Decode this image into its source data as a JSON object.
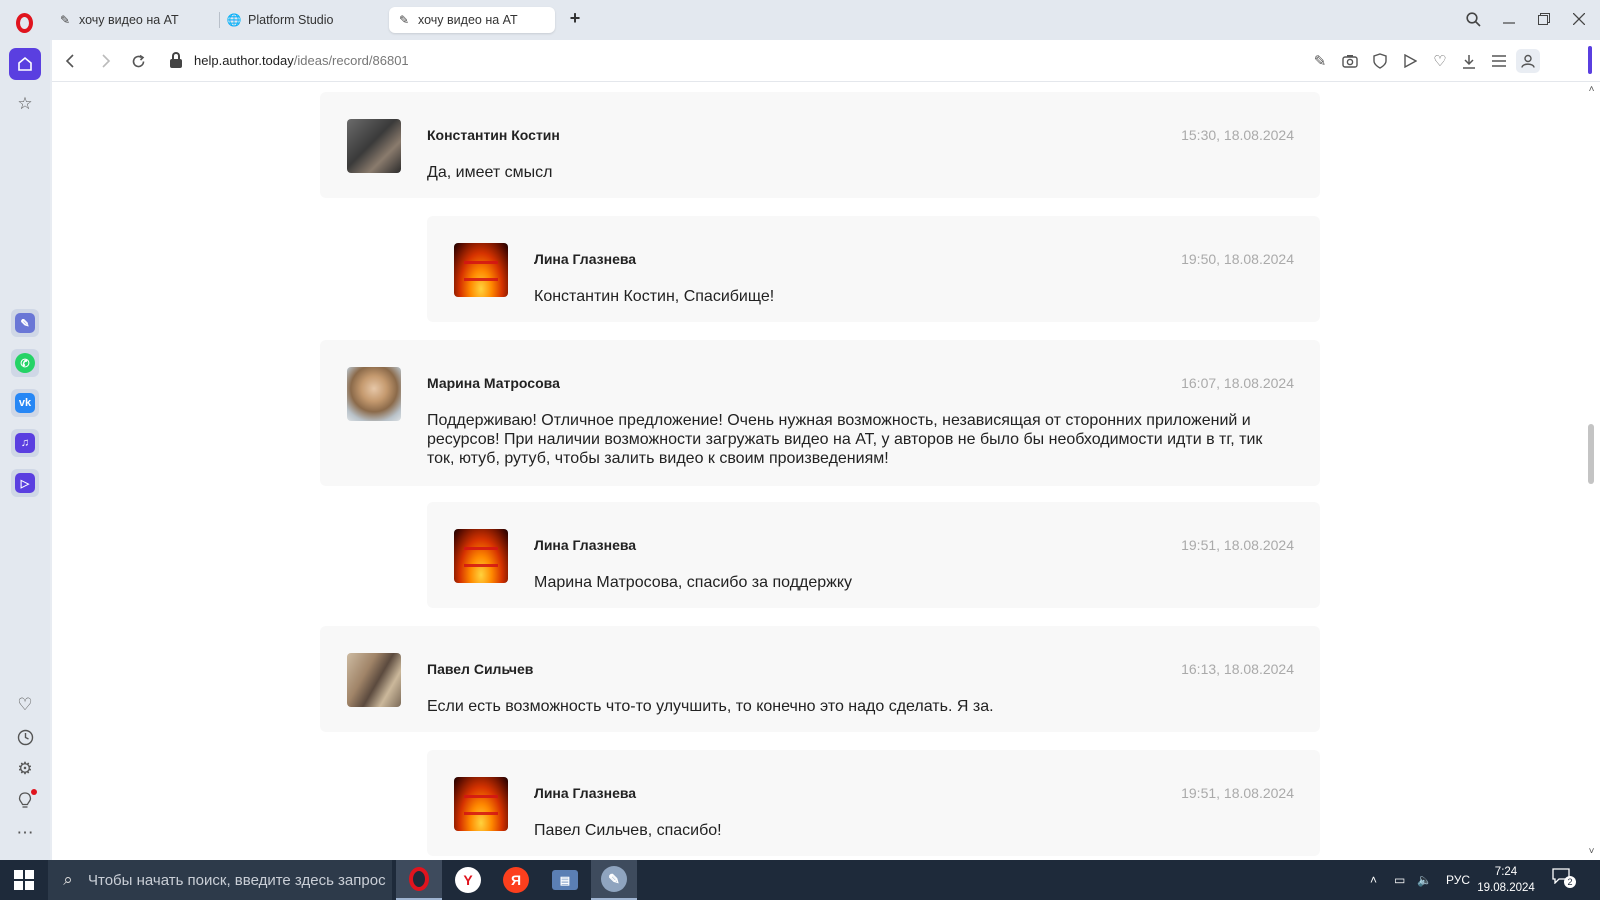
{
  "browser": {
    "tabs": [
      {
        "title": "хочу видео на АТ",
        "favicon": "author-today-icon",
        "active": false
      },
      {
        "title": "Platform Studio",
        "favicon": "globe-icon",
        "active": false
      },
      {
        "title": "хочу видео на АТ",
        "favicon": "author-today-icon",
        "active": true
      }
    ],
    "new_tab_label": "+",
    "url_host": "help.author.today",
    "url_path": "/ideas/record/86801"
  },
  "comments": [
    {
      "author": "Константин Костин",
      "date": "15:30, 18.08.2024",
      "text": "Да, имеет смысл",
      "kind": "top",
      "avatar": "photo"
    },
    {
      "author": "Лина Глазнева",
      "date": "19:50, 18.08.2024",
      "text": "Константин Костин, Спасибище!",
      "kind": "reply",
      "avatar": "fire-logo"
    },
    {
      "author": "Марина Матросова",
      "date": "16:07, 18.08.2024",
      "text": "Поддерживаю! Отличное предложение! Очень нужная возможность, независящая от сторонних приложений и ресурсов! При наличии возможности загружать видео на АТ, у авторов не было бы необходимости идти в тг, тик ток, ютуб, рутуб, чтобы залить видео к своим произведениям!",
      "kind": "top",
      "avatar": "photo"
    },
    {
      "author": "Лина Глазнева",
      "date": "19:51, 18.08.2024",
      "text": "Марина Матросова, спасибо за поддержку",
      "kind": "reply",
      "avatar": "fire-logo"
    },
    {
      "author": "Павел Сильчев",
      "date": "16:13, 18.08.2024",
      "text": "Если есть возможность что-то улучшить, то конечно это надо сделать. Я за.",
      "kind": "top",
      "avatar": "photo"
    },
    {
      "author": "Лина Глазнева",
      "date": "19:51, 18.08.2024",
      "text": "Павел Сильчев, спасибо!",
      "kind": "reply",
      "avatar": "fire-logo"
    }
  ],
  "taskbar": {
    "search_placeholder": "Чтобы начать поиск, введите здесь запрос",
    "language": "РУС",
    "time": "7:24",
    "date": "19.08.2024",
    "notification_count": "2",
    "apps": [
      "opera-icon",
      "yandex-browser-icon",
      "yandex-icon",
      "computer-icon",
      "paint-icon"
    ]
  },
  "colors": {
    "accent": "#5a3fe0",
    "opera_red": "#e0141e",
    "comment_bg": "#f8f8f8",
    "date_text": "#aaaaaa",
    "taskbar_bg": "#1e2a3a"
  }
}
